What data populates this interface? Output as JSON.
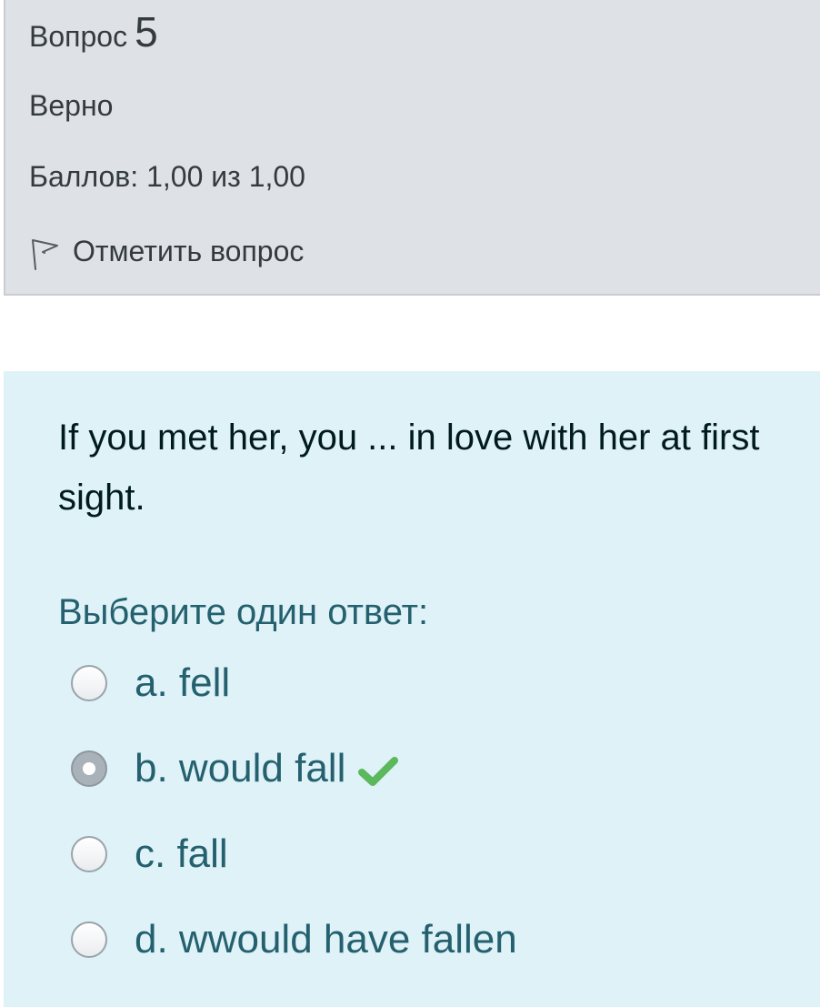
{
  "info": {
    "question_word": "Вопрос",
    "question_number": "5",
    "state": "Верно",
    "grade": "Баллов: 1,00 из 1,00",
    "flag_label": "Отметить вопрос"
  },
  "question": {
    "text": "If you met her, you ... in love with her at first sight.",
    "prompt": "Выберите один ответ:",
    "answers": [
      {
        "label": "a. fell",
        "selected": false
      },
      {
        "label": "b. would fall",
        "selected": true,
        "correct": true
      },
      {
        "label": "c. fall",
        "selected": false
      },
      {
        "label": "d. wwould have fallen",
        "selected": false
      }
    ]
  },
  "colors": {
    "info_bg": "#dee2e6",
    "content_bg": "#def2f8",
    "answer_text": "#24606e",
    "check_green": "#5cb85c"
  },
  "icons": {
    "flag": "flag-icon",
    "correct": "check-icon"
  }
}
